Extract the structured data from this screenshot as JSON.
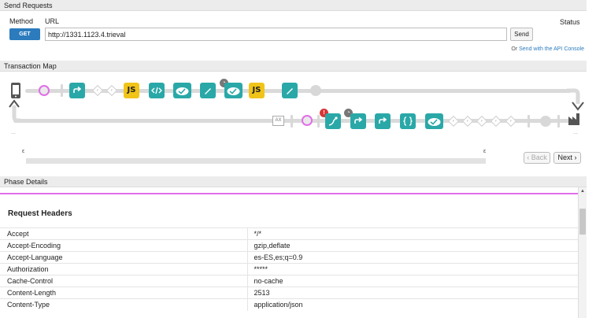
{
  "send_requests": {
    "title": "Send Requests",
    "method_label": "Method",
    "url_label": "URL",
    "status_label": "Status",
    "method_value": "GET",
    "url_value": "http://1331.1123.4.trieval",
    "send_label": "Send",
    "or_text": "Or",
    "api_console_link": "Send with the API Console"
  },
  "transaction_map": {
    "title": "Transaction Map",
    "js_label": "JS",
    "ax_label": "AX",
    "error_badge": "!",
    "diamond_label": "F",
    "back_label": "Back",
    "next_label": "Next",
    "colors": {
      "teal": "#2aa8a8",
      "js": "#f0c419",
      "active_ring": "#e16ee8",
      "error": "#d63636"
    }
  },
  "phase_details": {
    "title": "Phase Details",
    "request_headers_title": "Request Headers",
    "rows": [
      {
        "name": "Accept",
        "value": "*/*"
      },
      {
        "name": "Accept-Encoding",
        "value": "gzip,deflate"
      },
      {
        "name": "Accept-Language",
        "value": "es-ES,es;q=0.9"
      },
      {
        "name": "Authorization",
        "value": "*****"
      },
      {
        "name": "Cache-Control",
        "value": "no-cache"
      },
      {
        "name": "Content-Length",
        "value": "2513"
      },
      {
        "name": "Content-Type",
        "value": "application/json"
      }
    ]
  }
}
